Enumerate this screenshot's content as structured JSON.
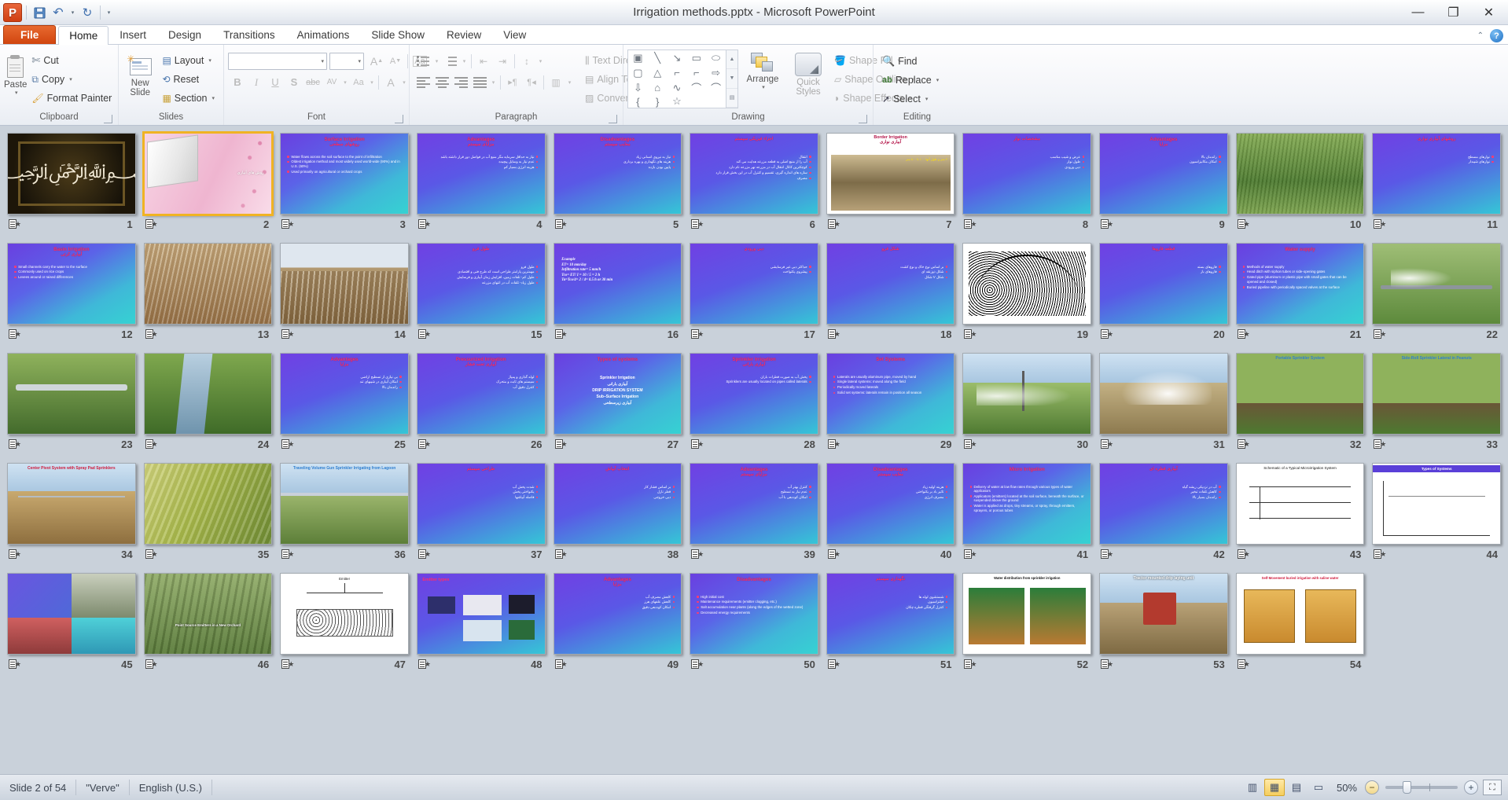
{
  "window": {
    "title": "Irrigation methods.pptx  -  Microsoft PowerPoint",
    "app_badge": "P",
    "minimize": "—",
    "restore": "❐",
    "close": "✕"
  },
  "quick_access": {
    "save": "💾",
    "undo": "↶",
    "redo": "↻",
    "customize": "▾"
  },
  "tabs": [
    {
      "label": "File",
      "active": false,
      "file": true
    },
    {
      "label": "Home",
      "active": true
    },
    {
      "label": "Insert",
      "active": false
    },
    {
      "label": "Design",
      "active": false
    },
    {
      "label": "Transitions",
      "active": false
    },
    {
      "label": "Animations",
      "active": false
    },
    {
      "label": "Slide Show",
      "active": false
    },
    {
      "label": "Review",
      "active": false
    },
    {
      "label": "View",
      "active": false
    }
  ],
  "tab_right": {
    "collapse": "⌃",
    "help": "?"
  },
  "ribbon": {
    "clipboard": {
      "label": "Clipboard",
      "paste": "Paste",
      "cut": "Cut",
      "copy": "Copy",
      "format_painter": "Format Painter"
    },
    "slides": {
      "label": "Slides",
      "new_slide": "New\nSlide",
      "new_slide_line1": "New",
      "new_slide_line2": "Slide",
      "layout": "Layout",
      "reset": "Reset",
      "section": "Section"
    },
    "font": {
      "label": "Font",
      "font_name": "",
      "font_size": "",
      "grow_font": "A",
      "shrink_font": "A",
      "clear_formatting": "Aa",
      "bold": "B",
      "italic": "I",
      "underline": "U",
      "shadow": "S",
      "strikethrough": "abc",
      "character_spacing": "AV",
      "change_case": "Aa",
      "font_color": "A"
    },
    "paragraph": {
      "label": "Paragraph",
      "bullets": "bullets",
      "numbering": "numbering",
      "decrease_indent": "decrease-indent",
      "increase_indent": "increase-indent",
      "line_spacing": "line-spacing",
      "align_left": "align-left",
      "center": "center",
      "align_right": "align-right",
      "justify": "justify",
      "ltr": "▸¶",
      "rtl": "¶◂",
      "columns": "columns",
      "text_direction": "Text Direction",
      "align_text": "Align Text",
      "convert_to_smartart": "Convert to SmartArt"
    },
    "drawing": {
      "label": "Drawing",
      "shapes": [
        "▣",
        "╲",
        "↘",
        "▭",
        "⬭",
        "▢",
        "△",
        "⌐",
        "⌐",
        "⇨",
        "⇩",
        "⌂",
        "∿",
        "⌒",
        "⌒",
        "{",
        "}",
        "☆"
      ],
      "gallery_up": "▲",
      "gallery_down": "▼",
      "gallery_more": "▤",
      "arrange": "Arrange",
      "quick_styles_line1": "Quick",
      "quick_styles_line2": "Styles",
      "shape_fill": "Shape Fill",
      "shape_outline": "Shape Outline",
      "shape_effects": "Shape Effects"
    },
    "editing": {
      "label": "Editing",
      "find": "Find",
      "replace": "Replace",
      "select": "Select"
    }
  },
  "status": {
    "slide_indicator": "Slide 2 of 54",
    "theme": "\"Verve\"",
    "language": "English (U.S.)",
    "zoom_level": "50%",
    "zoom_out": "−",
    "zoom_in": "+",
    "views": [
      {
        "name": "normal-view",
        "glyph": "▥",
        "active": false
      },
      {
        "name": "slide-sorter-view",
        "glyph": "▦",
        "active": true
      },
      {
        "name": "reading-view",
        "glyph": "▤",
        "active": false
      },
      {
        "name": "slide-show-view",
        "glyph": "▭",
        "active": false
      }
    ],
    "fit_to_window": "⛶"
  },
  "sorter": {
    "selected_slide": 2,
    "total_slides": 54,
    "slides": [
      {
        "n": 1,
        "kind": "calligraphy",
        "title_en": "",
        "title_fa": ""
      },
      {
        "n": 2,
        "kind": "pink-title",
        "title_fa": "روش های آبیاری"
      },
      {
        "n": 3,
        "kind": "verve-bullets",
        "title_en": "Surface Irrigation",
        "title_fa": "روشهای سطحی",
        "bullets": [
          "Water flows across the soil surface to the point of infiltration",
          "Oldest irrigation method and most widely used world-wide (90%) and in U.S. (60%)",
          "Used primarily on agricultural or orchard crops"
        ]
      },
      {
        "n": 4,
        "kind": "verve-rtl",
        "title_en": "Advantages",
        "title_fa": "مزایای سیستم",
        "bullets": [
          "نیاز به حداقل سرمایه مگر منبع آب در فواصل دور قرار داشته باشد",
          "عدم نیاز به وسایل پیچیده",
          "هزینه انرژی بسیار کم"
        ]
      },
      {
        "n": 5,
        "kind": "verve-rtl",
        "title_en": "Disadvantages",
        "title_fa": "معایب سیستم",
        "bullets": [
          "نیاز به نیروی انسانی زیاد",
          "هزینه های نگهداری و بهره برداری",
          "پایین بودن بازده"
        ]
      },
      {
        "n": 6,
        "kind": "verve-rtl",
        "title_en": "",
        "title_fa": "اجزاء فیزیکی سیستم",
        "bullets": [
          "انتقال",
          "آب را از منبع اصلی به قطعه مزرعه هدایت می کند",
          "کوچکترین کانال انتقال آب در مزرعه نهر مزرعه نام دارد",
          "سازه های اندازه گیری، تقسیم و کنترل آب در این بخش قرار دارد",
          "مصرف"
        ]
      },
      {
        "n": 7,
        "kind": "border-photo",
        "title_en": "Border Irrigation",
        "title_fa": "آبیاری نواری"
      },
      {
        "n": 8,
        "kind": "verve-rtl",
        "title_en": "",
        "title_fa": "مشخصات نوار",
        "bullets": [
          "عرض و شیب مناسب",
          "طول نوار",
          "دبی ورودی"
        ]
      },
      {
        "n": 9,
        "kind": "verve-rtl",
        "title_en": "Advantages",
        "title_fa": "مزایا",
        "bullets": [
          "راندمان بالا",
          "امکان مکانیزاسیون"
        ]
      },
      {
        "n": 10,
        "kind": "photo-field",
        "caption": ""
      },
      {
        "n": 11,
        "kind": "verve-rtl",
        "title_en": "",
        "title_fa": "روشهای آبیاری نواری",
        "bullets": [
          "نوارهای مسطح",
          "نوارهای شیبدار"
        ]
      },
      {
        "n": 12,
        "kind": "verve-bullets",
        "title_en": "Basin Irrigation",
        "title_fa": "آبیاری کرتی",
        "bullets": [
          "Small channels carry the water to the surface",
          "Commonly used on rice crops",
          "Levees around or raised differences"
        ]
      },
      {
        "n": 13,
        "kind": "photo-rows",
        "caption": ""
      },
      {
        "n": 14,
        "kind": "photo-furrow",
        "caption": ""
      },
      {
        "n": 15,
        "kind": "verve-rtl",
        "title_en": "",
        "title_fa": "طول فرو",
        "bullets": [
          "طول فرو",
          "مهمترین پارامتر طراحی است که طرح فنی و اقتصادی",
          "طول کم- تلفات زمین، افزایش زمان آبیاری و فرسایش",
          "طول زیاد- تلفات آب در انتهای مزرعه"
        ]
      },
      {
        "n": 16,
        "kind": "formula",
        "title_en": "",
        "title_fa": "",
        "lines": [
          "Example",
          "ET= 10 mm/day",
          "Infiltration rate= 5 mm/h",
          "Tco= ET/ I = 10 / 5 = 2 h",
          "Ta=Tco/4= 2 / 4= 0.5 h or 30 min"
        ]
      },
      {
        "n": 17,
        "kind": "verve-rtl",
        "title_en": "",
        "title_fa": "دبی ورودی",
        "bullets": [
          "حداکثر دبی غیر فرسایشی",
          "پیشروی یکنواخت"
        ]
      },
      {
        "n": 18,
        "kind": "verve-rtl",
        "title_en": "",
        "title_fa": "شکل فرو",
        "bullets": [
          "بر اساس نوع خاک و نوع کشت",
          "شکل ذوزنقه ای",
          "شکل V شکل"
        ]
      },
      {
        "n": 19,
        "kind": "diagram-furrow",
        "caption": ""
      },
      {
        "n": 20,
        "kind": "verve-rtl",
        "title_en": "",
        "title_fa": "قطعه فاروها",
        "bullets": [
          "فاروهای بسته",
          "فاروهای باز"
        ]
      },
      {
        "n": 21,
        "kind": "verve-bullets",
        "title_en": "Water supply",
        "title_fa": "",
        "bullets": [
          "Methods of water supply",
          "Head ditch with siphon tubes or side-opening gates",
          "Gated pipe (aluminum or plastic pipe with small gates that can be opened and closed)",
          "Buried pipeline with periodically spaced valves at the surface"
        ]
      },
      {
        "n": 22,
        "kind": "photo-pipe",
        "caption": ""
      },
      {
        "n": 23,
        "kind": "photo-pipe2",
        "caption": ""
      },
      {
        "n": 24,
        "kind": "photo-stream",
        "caption": ""
      },
      {
        "n": 25,
        "kind": "verve-rtl",
        "title_en": "Advantages",
        "title_fa": "مزایا",
        "bullets": [
          "بی نیازی از تسطیح اراضی",
          "امکان آبیاری در شیبهای تند",
          "راندمان بالا"
        ]
      },
      {
        "n": 26,
        "kind": "verve-rtl",
        "title_en": "Pressurized Irrigation",
        "title_fa": "آبیاری تحت فشار",
        "bullets": [
          "لوله گذاری و پمپاژ",
          "سیستم های ثابت و متحرک",
          "کنترل دقیق آب"
        ]
      },
      {
        "n": 27,
        "kind": "types",
        "title_en": "Types of systems",
        "items": [
          "Sprinkler Irrigation",
          "آبیاری بارانی",
          "DRIP IRRIGATION SYSTEM",
          "Sub–Surface Irrigation",
          "آبیاری زیرسطحی"
        ]
      },
      {
        "n": 28,
        "kind": "verve-rtl",
        "title_en": "Sprinkler Irrigation",
        "title_fa": "آبیاری بارانی",
        "bullets": [
          "پخش آب به صورت قطرات باران",
          "Sprinklers are usually located on pipes called laterals"
        ]
      },
      {
        "n": 29,
        "kind": "verve-bullets",
        "title_en": "Set Systems",
        "title_fa": "",
        "bullets": [
          "Laterals are usually aluminum pipe, moved by hand",
          "Single lateral systems: moved along the field",
          "Periodically moved laterals",
          "Solid set systems: laterals remain in position all season"
        ]
      },
      {
        "n": 30,
        "kind": "photo-sprinkler",
        "caption": ""
      },
      {
        "n": 31,
        "kind": "photo-sprinkler2",
        "caption": ""
      },
      {
        "n": 32,
        "kind": "photo-lateral",
        "caption": "Portable Sprinkler System"
      },
      {
        "n": 33,
        "kind": "photo-lateral2",
        "caption": "Side-Roll Sprinkler Lateral in Peanuts"
      },
      {
        "n": 34,
        "kind": "photo-pivot",
        "caption": "Center Pivot System with Spray Pad Sprinklers"
      },
      {
        "n": 35,
        "kind": "photo-linear",
        "caption": ""
      },
      {
        "n": 36,
        "kind": "photo-gun",
        "caption": "Traveling Volume Gun Sprinkler Irrigating from Lagoon"
      },
      {
        "n": 37,
        "kind": "verve-rtl",
        "title_en": "",
        "title_fa": "طراحی سیستم",
        "bullets": [
          "شدت پخش آب",
          "یکنواختی پخش",
          "فاصله آبپاشها"
        ]
      },
      {
        "n": 38,
        "kind": "verve-rtl",
        "title_en": "",
        "title_fa": "انتخاب آبپاش",
        "bullets": [
          "بر اساس فشار کار",
          "قطر نازل",
          "دبی خروجی"
        ]
      },
      {
        "n": 39,
        "kind": "verve-rtl",
        "title_en": "Advantages",
        "title_fa": "مزایای سیستم",
        "bullets": [
          "کنترل بهتر آب",
          "عدم نیاز به تسطیح",
          "امکان کوددهی با آب"
        ]
      },
      {
        "n": 40,
        "kind": "verve-rtl",
        "title_en": "Disadvantages",
        "title_fa": "معایب سیستم",
        "bullets": [
          "هزینه اولیه زیاد",
          "تاثیر باد بر یکنواختی",
          "مصرف انرژی"
        ]
      },
      {
        "n": 41,
        "kind": "verve-bullets",
        "title_en": "Micro Irrigation",
        "title_fa": "",
        "bullets": [
          "Delivery of water at low flow rates through various types of water applicators",
          "Applicators (emitters) located at the soil surface, beneath the surface, or suspended above the ground",
          "Water is applied as drops, tiny streams, or spray, through emitters, sprayers, or porous tubes"
        ]
      },
      {
        "n": 42,
        "kind": "verve-rtl",
        "title_en": "",
        "title_fa": "آبیاری قطره ای",
        "bullets": [
          "آب در نزدیکی ریشه گیاه",
          "کاهش تلفات تبخیر",
          "راندمان بسیار بالا"
        ]
      },
      {
        "n": 43,
        "kind": "diagram-micro",
        "caption": "Schematic of a Typical  Microirrigation System"
      },
      {
        "n": 44,
        "kind": "diagram-chart",
        "caption": "Types of Systems"
      },
      {
        "n": 45,
        "kind": "photo-pump",
        "caption": ""
      },
      {
        "n": 46,
        "kind": "photo-orchard",
        "caption": "Point Source Emitters in a New Orchard"
      },
      {
        "n": 47,
        "kind": "diagram-emitter",
        "caption": "Emitter"
      },
      {
        "n": 48,
        "kind": "emitter-types",
        "caption": "Emitter types"
      },
      {
        "n": 49,
        "kind": "verve-rtl",
        "title_en": "Advantages",
        "title_fa": "مزایا",
        "bullets": [
          "کاهش مصرف آب",
          "کاهش علفهای هرز",
          "امکان کوددهی دقیق"
        ]
      },
      {
        "n": 50,
        "kind": "verve-bullets",
        "title_en": "Disadvantages",
        "title_fa": "",
        "bullets": [
          "High initial cost",
          "Maintenance requirements (emitter clogging, etc.)",
          "Salt accumulation near plants (along the edges of the wetted zone)",
          "Decreased energy requirements"
        ]
      },
      {
        "n": 51,
        "kind": "verve-rtl",
        "title_en": "",
        "title_fa": "نگهداری سیستم",
        "bullets": [
          "شستشوی لوله ها",
          "فیلتراسیون",
          "کنترل گرفتگی قطره چکان"
        ]
      },
      {
        "n": 52,
        "kind": "diagram-wetting",
        "caption": "Water distribution from sprinkler irrigation"
      },
      {
        "n": 53,
        "kind": "photo-tractor",
        "caption": "Tractor mounted drip laying unit"
      },
      {
        "n": 54,
        "kind": "diagram-subsurface",
        "caption": "Self-Movement buried irrigation with saline water"
      }
    ]
  }
}
